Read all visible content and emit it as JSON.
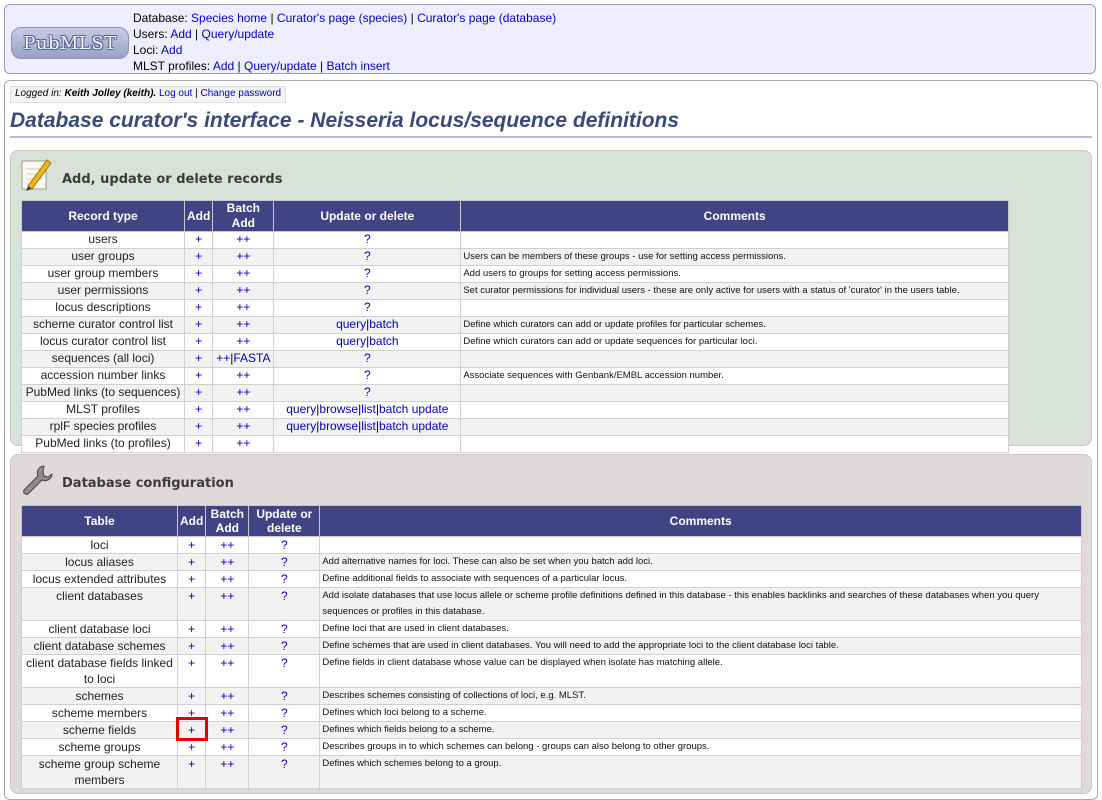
{
  "menu": {
    "database_label": "Database:",
    "database_links": [
      "Species home",
      "Curator's page (species)",
      "Curator's page (database)"
    ],
    "users_label": "Users:",
    "users_links": [
      "Add",
      "Query/update"
    ],
    "loci_label": "Loci:",
    "loci_links": [
      "Add"
    ],
    "mlst_label": "MLST profiles:",
    "mlst_links": [
      "Add",
      "Query/update",
      "Batch insert"
    ],
    "sep": "|"
  },
  "logo_text": "PubMLST",
  "login": {
    "prefix": "Logged in: ",
    "user": "Keith Jolley (keith).",
    "logout": "Log out",
    "change_password": "Change password"
  },
  "page_title": "Database curator's interface - Neisseria locus/sequence definitions",
  "records": {
    "heading": "Add, update or delete records",
    "icon": "pencil-note-icon",
    "headers": [
      "Record type",
      "Add",
      "Batch Add",
      "Update or delete",
      "Comments"
    ],
    "rows": [
      {
        "name": "users",
        "add": "+",
        "batch": [
          "++"
        ],
        "update": [
          "?"
        ],
        "comment": ""
      },
      {
        "name": "user groups",
        "add": "+",
        "batch": [
          "++"
        ],
        "update": [
          "?"
        ],
        "comment": "Users can be members of these groups - use for setting access permissions."
      },
      {
        "name": "user group members",
        "add": "+",
        "batch": [
          "++"
        ],
        "update": [
          "?"
        ],
        "comment": "Add users to groups for setting access permissions."
      },
      {
        "name": "user permissions",
        "add": "+",
        "batch": [
          "++"
        ],
        "update": [
          "?"
        ],
        "comment": "Set curator permissions for individual users - these are only active for users with a status of 'curator' in the users table."
      },
      {
        "name": "locus descriptions",
        "add": "+",
        "batch": [
          "++"
        ],
        "update": [
          "?"
        ],
        "comment": ""
      },
      {
        "name": "scheme curator control list",
        "add": "+",
        "batch": [
          "++"
        ],
        "update": [
          "query",
          "batch"
        ],
        "comment": "Define which curators can add or update profiles for particular schemes."
      },
      {
        "name": "locus curator control list",
        "add": "+",
        "batch": [
          "++"
        ],
        "update": [
          "query",
          "batch"
        ],
        "comment": "Define which curators can add or update sequences for particular loci."
      },
      {
        "name": "sequences (all loci)",
        "add": "+",
        "batch": [
          "++",
          "FASTA"
        ],
        "update": [
          "?"
        ],
        "comment": ""
      },
      {
        "name": "accession number links",
        "add": "+",
        "batch": [
          "++"
        ],
        "update": [
          "?"
        ],
        "comment": "Associate sequences with Genbank/EMBL accession number."
      },
      {
        "name": "PubMed links (to sequences)",
        "add": "+",
        "batch": [
          "++"
        ],
        "update": [
          "?"
        ],
        "comment": ""
      },
      {
        "name": "MLST profiles",
        "add": "+",
        "batch": [
          "++"
        ],
        "update": [
          "query",
          "browse",
          "list",
          "batch update"
        ],
        "comment": ""
      },
      {
        "name": "rplF species profiles",
        "add": "+",
        "batch": [
          "++"
        ],
        "update": [
          "query",
          "browse",
          "list",
          "batch update"
        ],
        "comment": ""
      },
      {
        "name": "PubMed links (to profiles)",
        "add": "+",
        "batch": [
          "++"
        ],
        "update": [],
        "comment": ""
      }
    ]
  },
  "config": {
    "heading": "Database configuration",
    "icon": "wrench-icon",
    "headers": [
      "Table",
      "Add",
      "Batch Add",
      "Update or delete",
      "Comments"
    ],
    "rows": [
      {
        "name": "loci",
        "add": "+",
        "batch": "++",
        "update": "?",
        "comment": ""
      },
      {
        "name": "locus aliases",
        "add": "+",
        "batch": "++",
        "update": "?",
        "comment": "Add alternative names for loci. These can also be set when you batch add loci."
      },
      {
        "name": "locus extended attributes",
        "add": "+",
        "batch": "++",
        "update": "?",
        "comment": "Define additional fields to associate with sequences of a particular locus."
      },
      {
        "name": "client databases",
        "add": "+",
        "batch": "++",
        "update": "?",
        "comment": "Add isolate databases that use locus allele or scheme profile definitions defined in this database - this enables backlinks and searches of these databases when you query sequences or profiles in this database."
      },
      {
        "name": "client database loci",
        "add": "+",
        "batch": "++",
        "update": "?",
        "comment": "Define loci that are used in client databases."
      },
      {
        "name": "client database schemes",
        "add": "+",
        "batch": "++",
        "update": "?",
        "comment": "Define schemes that are used in client databases. You will need to add the appropriate loci to the client database loci table."
      },
      {
        "name": "client database fields linked to loci",
        "add": "+",
        "batch": "++",
        "update": "?",
        "comment": "Define fields in client database whose value can be displayed when isolate has matching allele."
      },
      {
        "name": "schemes",
        "add": "+",
        "batch": "++",
        "update": "?",
        "comment": "Describes schemes consisting of collections of loci, e.g. MLST."
      },
      {
        "name": "scheme members",
        "add": "+",
        "batch": "++",
        "update": "?",
        "comment": "Defines which loci belong to a scheme."
      },
      {
        "name": "scheme fields",
        "add": "+",
        "batch": "++",
        "update": "?",
        "comment": "Defines which fields belong to a scheme."
      },
      {
        "name": "scheme groups",
        "add": "+",
        "batch": "++",
        "update": "?",
        "comment": "Describes groups in to which schemes can belong - groups can also belong to other groups."
      },
      {
        "name": "scheme group scheme members",
        "add": "+",
        "batch": "++",
        "update": "?",
        "comment": "Defines which schemes belong to a group."
      }
    ]
  },
  "colors": {
    "header_bg": "#404484",
    "records_panel": "#d9e2d9",
    "config_panel": "#e0d9d9",
    "highlight": "#e00000",
    "link": "#0000cc"
  }
}
